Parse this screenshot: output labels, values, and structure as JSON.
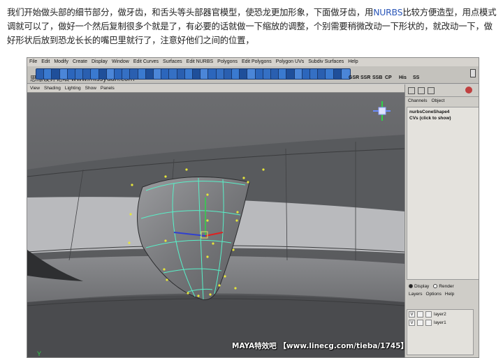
{
  "intro": {
    "before": "我们开始做头部的细节部分，做牙齿，和舌头等头部器官模型，使恐龙更加形象，下面做牙齿，用",
    "highlight": "NURBS",
    "after": "比较方便造型，用点模式调就可以了，做好一个然后复制很多个就是了，有必要的话就做一下缩放的调整，个别需要稍微改动一下形状的，就改动一下，做好形状后放到恐龙长长的嘴巴里就行了，注意好他们之间的位置，"
  },
  "app": {
    "menus": [
      "File",
      "Edit",
      "Modify",
      "Create",
      "Display",
      "Window",
      "Edit Curves",
      "Surfaces",
      "Edit NURBS",
      "Polygons",
      "Edit Polygons",
      "Polygon UVs",
      "Subdiv Surfaces",
      "Help"
    ],
    "watermark": "思缘设计论坛  www.missyuan.com",
    "shelf_labels": [
      "GSR",
      "SSR",
      "SSB",
      "CP",
      "His",
      "SS"
    ],
    "panel_menus": [
      "View",
      "Shading",
      "Lighting",
      "Show",
      "Panels"
    ],
    "channel_tabs": [
      "Channels",
      "Object"
    ],
    "node_name": "nurbsConeShape4",
    "node_sub": "CVs (click to show)",
    "display_options": [
      "Display",
      "Render"
    ],
    "layer_menus": [
      "Layers",
      "Options",
      "Help"
    ],
    "layers": [
      {
        "vis": "V",
        "name": "layer2"
      },
      {
        "vis": "V",
        "name": "layer1"
      }
    ],
    "axis_label": "Y"
  },
  "credit": "MAYA特效吧  【www.linecg.com/tieba/1745】",
  "colors": {
    "viewport_bg": "#5e5f62",
    "wireframe": "#58f0c8",
    "cv_point": "#e6e63a",
    "highlight_text": "#2a56b8"
  }
}
